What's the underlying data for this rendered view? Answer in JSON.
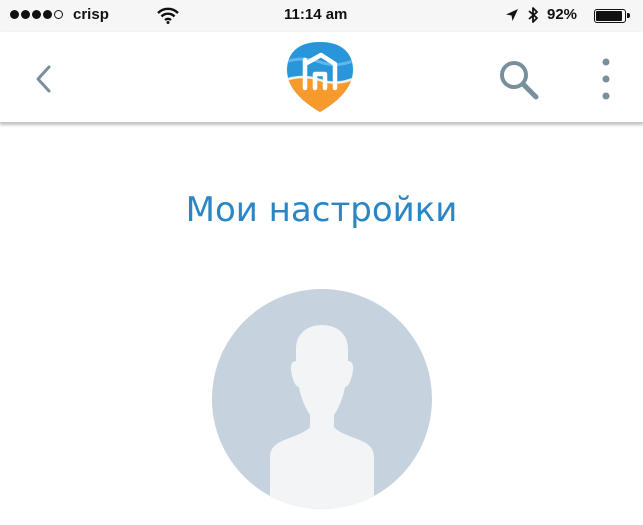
{
  "status_bar": {
    "carrier": "crisp",
    "time": "11:14 am",
    "battery_percent": "92%",
    "battery_level": 0.92,
    "signal_bars_filled": 4,
    "signal_bars_total": 5,
    "icons": [
      "signal-dots-icon",
      "wifi-icon",
      "location-arrow-icon",
      "bluetooth-icon",
      "battery-icon"
    ]
  },
  "nav_bar": {
    "icons": [
      "chevron-left-icon",
      "home-logo-icon",
      "search-icon",
      "more-vertical-icon"
    ]
  },
  "settings": {
    "title": "Мои настройки"
  },
  "colors": {
    "title": "#2a86c5",
    "avatar_bg": "#c6d3de",
    "avatar_silhouette": "#f2f4f6",
    "nav_icons": "#78909c",
    "logo_blue": "#2896d8",
    "logo_orange": "#f79a2e"
  }
}
